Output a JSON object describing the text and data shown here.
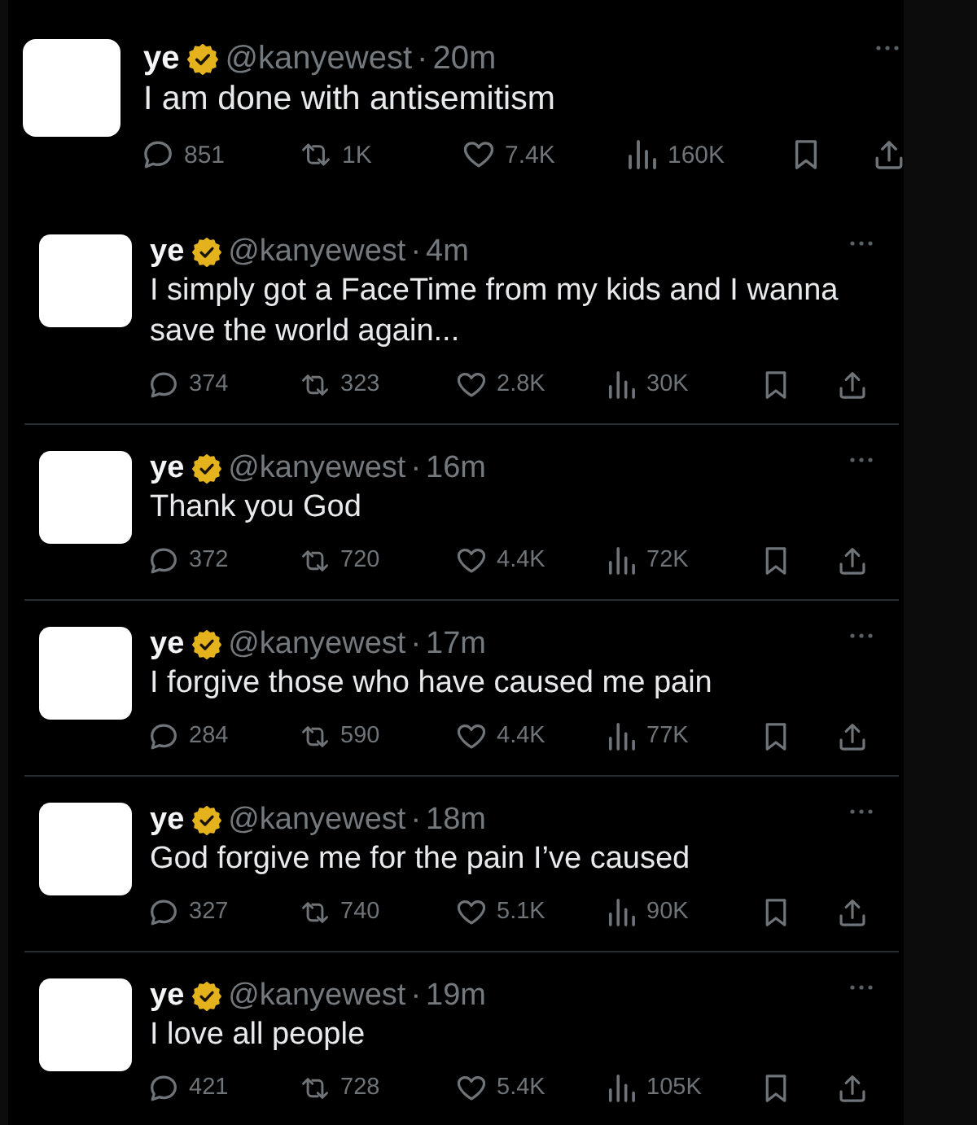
{
  "tweets": [
    {
      "name": "ye",
      "handle": "@kanyewest",
      "separator": "·",
      "time": "20m",
      "text": "I am done with antisemitism",
      "replies": "851",
      "reposts": "1K",
      "likes": "7.4K",
      "views": "160K"
    },
    {
      "name": "ye",
      "handle": "@kanyewest",
      "separator": "·",
      "time": "4m",
      "text": "I simply got a FaceTime from my kids and I wanna save the world again...",
      "replies": "374",
      "reposts": "323",
      "likes": "2.8K",
      "views": "30K"
    },
    {
      "name": "ye",
      "handle": "@kanyewest",
      "separator": "·",
      "time": "16m",
      "text": "Thank you God",
      "replies": "372",
      "reposts": "720",
      "likes": "4.4K",
      "views": "72K"
    },
    {
      "name": "ye",
      "handle": "@kanyewest",
      "separator": "·",
      "time": "17m",
      "text": "I forgive those who have caused me pain",
      "replies": "284",
      "reposts": "590",
      "likes": "4.4K",
      "views": "77K"
    },
    {
      "name": "ye",
      "handle": "@kanyewest",
      "separator": "·",
      "time": "18m",
      "text": "God forgive me for the pain I’ve caused",
      "replies": "327",
      "reposts": "740",
      "likes": "5.1K",
      "views": "90K"
    },
    {
      "name": "ye",
      "handle": "@kanyewest",
      "separator": "·",
      "time": "19m",
      "text": "I love all people",
      "replies": "421",
      "reposts": "728",
      "likes": "5.4K",
      "views": "105K"
    }
  ]
}
